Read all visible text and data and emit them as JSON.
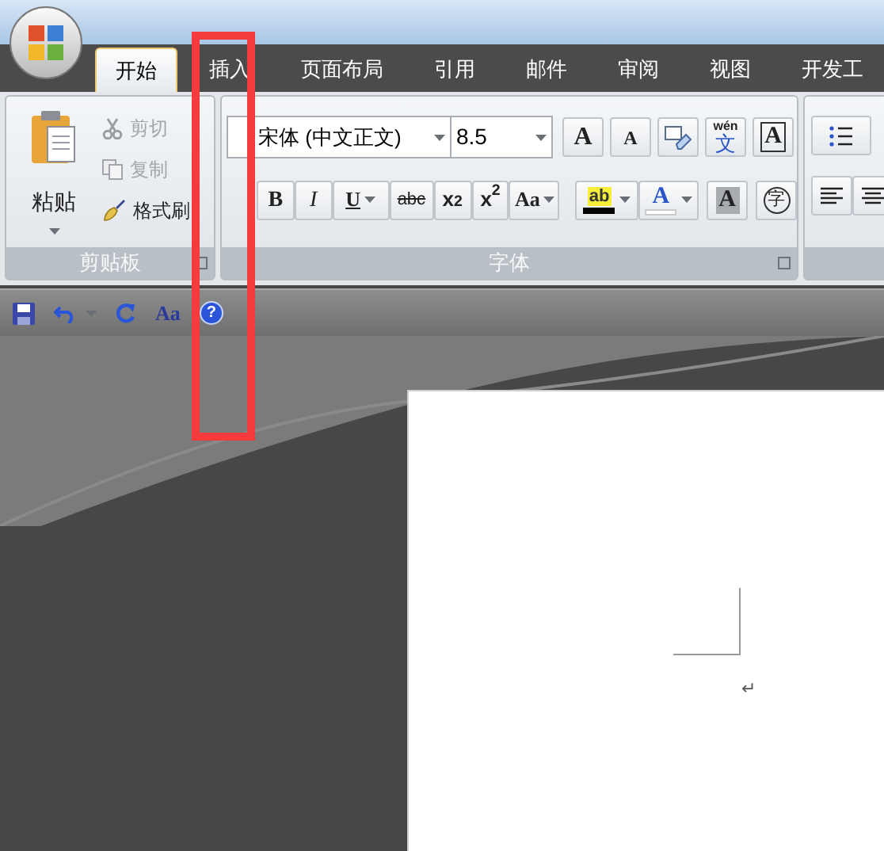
{
  "tabs": [
    {
      "label": "开始",
      "selected": true
    },
    {
      "label": "插入",
      "selected": false
    },
    {
      "label": "页面布局",
      "selected": false
    },
    {
      "label": "引用",
      "selected": false
    },
    {
      "label": "邮件",
      "selected": false
    },
    {
      "label": "审阅",
      "selected": false
    },
    {
      "label": "视图",
      "selected": false
    },
    {
      "label": "开发工",
      "selected": false
    }
  ],
  "clipboard": {
    "label": "剪贴板",
    "paste": "粘贴",
    "commands": [
      {
        "kind": "cut",
        "label": "剪切",
        "disabled": true
      },
      {
        "kind": "copy",
        "label": "复制",
        "disabled": true
      },
      {
        "kind": "painter",
        "label": "格式刷",
        "disabled": false
      }
    ]
  },
  "font": {
    "label": "字体",
    "font_name": "宋体 (中文正文)",
    "font_size": "8.5",
    "row1": [
      {
        "kind": "grow",
        "text": "A"
      },
      {
        "kind": "shrink",
        "text": "A"
      },
      {
        "kind": "clear"
      },
      {
        "kind": "phonetic",
        "text": "wén",
        "sub": "文"
      },
      {
        "kind": "border",
        "text": "A"
      }
    ],
    "row2": [
      {
        "kind": "bold",
        "text": "B"
      },
      {
        "kind": "italic",
        "text": "I"
      },
      {
        "kind": "underline",
        "text": "U"
      },
      {
        "kind": "strike",
        "text": "abc"
      },
      {
        "kind": "subscript",
        "text": "x$_{2}$"
      },
      {
        "kind": "superscript",
        "text": "x$^{2}$"
      },
      {
        "kind": "case",
        "text": "Aa"
      },
      {
        "kind": "highlight",
        "text": "ab",
        "color": "#000000"
      },
      {
        "kind": "fontcolor",
        "text": "A",
        "color": "#ffffff"
      },
      {
        "kind": "shading",
        "text": "A"
      },
      {
        "kind": "enclose",
        "text": "字"
      }
    ]
  },
  "quick_access": [
    {
      "kind": "save"
    },
    {
      "kind": "undo"
    },
    {
      "kind": "redo"
    },
    {
      "kind": "text",
      "text": "Aa"
    },
    {
      "kind": "help",
      "text": "?"
    }
  ],
  "document": {
    "paragraph_mark": "↵"
  },
  "annotation": {
    "kind": "highlight-box"
  }
}
